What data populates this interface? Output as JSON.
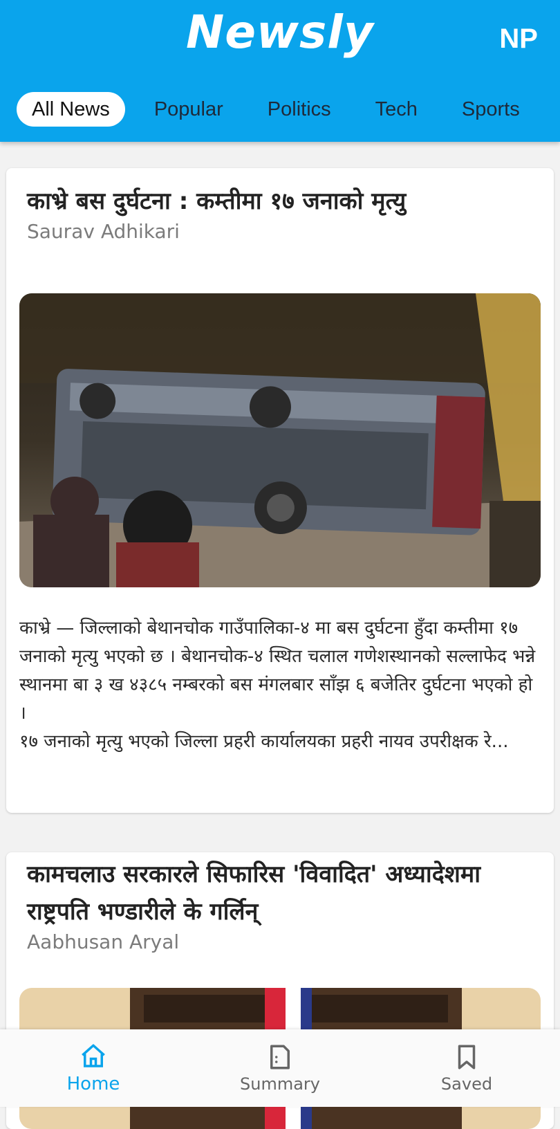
{
  "app": {
    "title": "Newsly",
    "language_label": "NP"
  },
  "tabs": [
    {
      "label": "All News",
      "active": true
    },
    {
      "label": "Popular"
    },
    {
      "label": "Politics"
    },
    {
      "label": "Tech"
    },
    {
      "label": "Sports"
    }
  ],
  "articles": [
    {
      "headline": "काभ्रे बस दुर्घटना : कम्तीमा १७ जनाको मृत्यु",
      "author": "Saurav Adhikari",
      "excerpt": "काभ्रे — जिल्लाको बेथानचोक गाउँपालिका-४ मा बस दुर्घटना हुँदा कम्तीमा १७ जनाको मृत्यु भएको छ । बेथानचोक-४ स्थित चलाल गणेशस्थानको सल्लाफेद भन्ने स्थानमा बा ३ ख ४३८५ नम्बरको बस मंगलबार साँझ ६ बजेतिर दुर्घटना भएको हो ।\n१७ जनाको मृत्यु भएको जिल्ला प्रहरी कार्यालयका प्रहरी नायव उपरीक्षक रे..."
    },
    {
      "headline": "कामचलाउ सरकारले सिफारिस 'विवादित' अध्यादेशमा राष्ट्रपति भण्डारीले के गर्लिन्",
      "author": "Aabhusan Aryal"
    }
  ],
  "bottom_nav": [
    {
      "label": "Home",
      "icon": "home-icon",
      "active": true
    },
    {
      "label": "Summary",
      "icon": "summary-icon"
    },
    {
      "label": "Saved",
      "icon": "bookmark-icon"
    }
  ],
  "colors": {
    "accent": "#0aa4ec",
    "background": "#f2f2f2"
  }
}
